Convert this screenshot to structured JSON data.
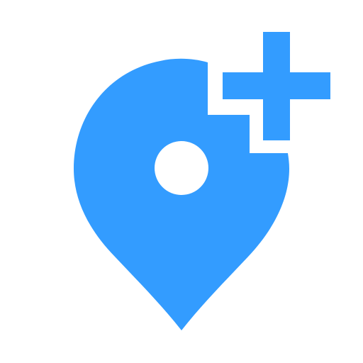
{
  "icon": {
    "name": "add-location-icon",
    "parts": [
      "map-pin-icon",
      "plus-icon"
    ]
  },
  "colors": {
    "accent": "#339CFF",
    "background": "#FFFFFF"
  }
}
